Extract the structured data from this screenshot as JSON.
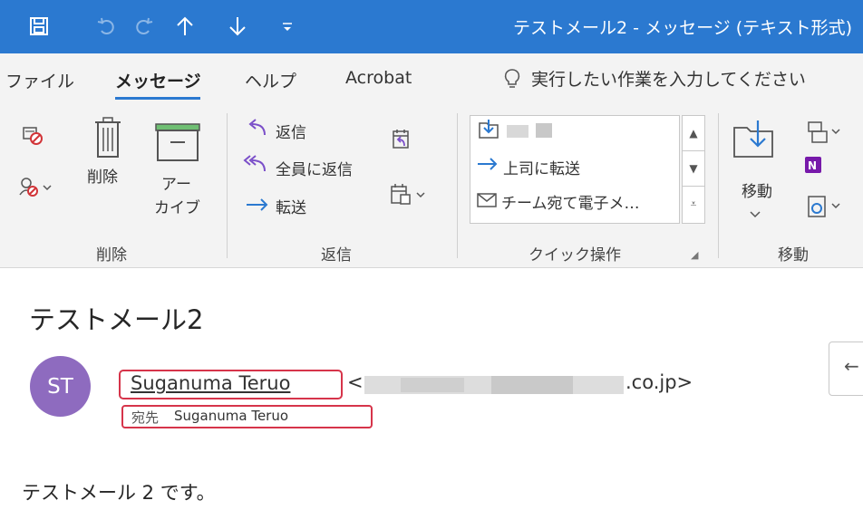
{
  "window": {
    "title": "テストメール2 - メッセージ (テキスト形式)"
  },
  "menu": {
    "tabs": [
      {
        "label": "ファイル"
      },
      {
        "label": "メッセージ"
      },
      {
        "label": "ヘルプ"
      },
      {
        "label": "Acrobat"
      }
    ],
    "tell_me": "実行したい作業を入力してください"
  },
  "ribbon": {
    "delete_group": {
      "label": "削除",
      "delete_button": "削除",
      "archive_button_line1": "アー",
      "archive_button_line2": "カイブ"
    },
    "reply_group": {
      "label": "返信",
      "reply": "返信",
      "reply_all": "全員に返信",
      "forward": "転送"
    },
    "quick_steps_group": {
      "label": "クイック操作",
      "items": [
        {
          "label": ""
        },
        {
          "label": "上司に転送"
        },
        {
          "label": "チーム宛て電子メ…"
        }
      ]
    },
    "move_group": {
      "label": "移動",
      "move_button": "移動"
    }
  },
  "message": {
    "subject": "テストメール2",
    "avatar_initials": "ST",
    "sender_name": "Suganuma Teruo",
    "sender_email_lt": "<",
    "sender_email_domain": ".co.jp>",
    "to_label": "宛先",
    "to_name": "Suganuma Teruo",
    "body": "テストメール 2 です。"
  },
  "colors": {
    "accent": "#2b79d0",
    "highlight_red": "#d6344a",
    "avatar_bg": "#8e6bbf"
  }
}
